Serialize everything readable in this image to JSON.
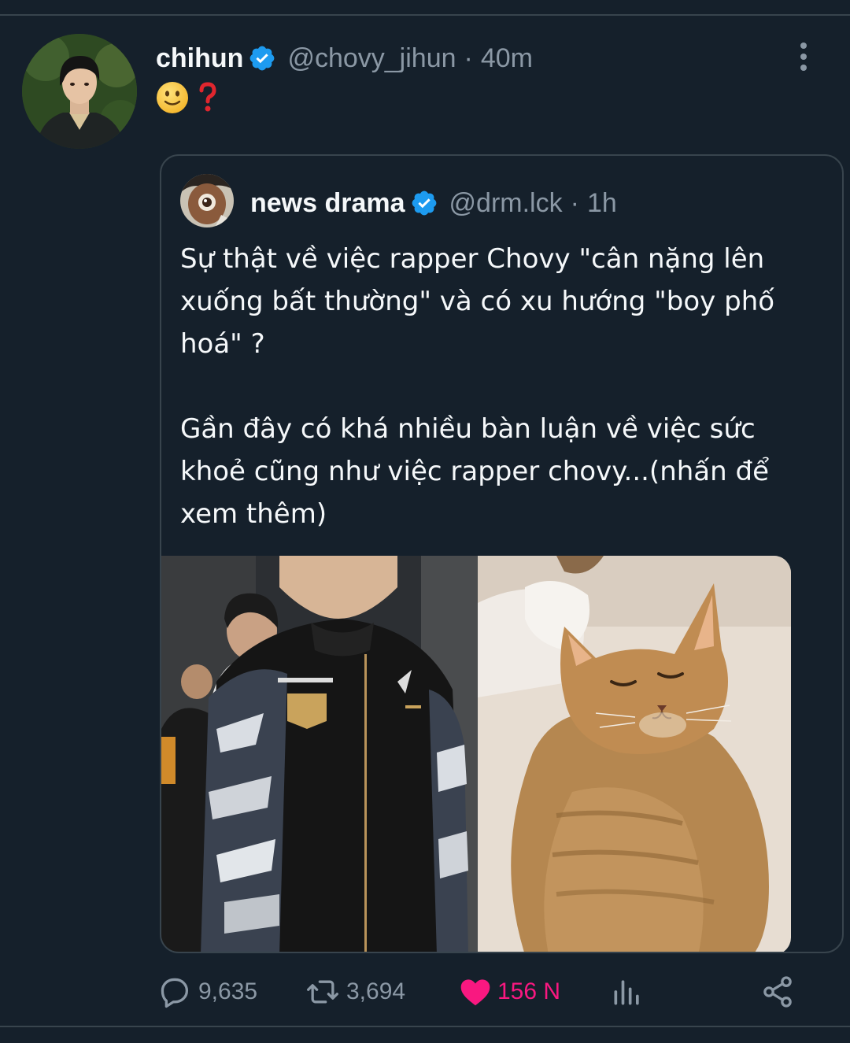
{
  "tweet": {
    "author": {
      "display_name": "chihun",
      "handle": "@chovy_jihun",
      "verified": true
    },
    "separator": "·",
    "time": "40m",
    "content_emoji": [
      "slightly-smiling-face",
      "red-question-mark"
    ],
    "quote": {
      "author": {
        "display_name": "news drama",
        "handle": "@drm.lck",
        "verified": true
      },
      "separator": "·",
      "time": "1h",
      "text_paragraph_1": "Sự thật về việc rapper Chovy \"cân nặng lên xuống bất thường\" và có xu hướng \"boy phố hoá\" ?",
      "text_paragraph_2": "Gần đây có khá nhiều bàn luận về việc sức khoẻ cũng như việc rapper chovy...(nhấn để xem thêm)",
      "media": [
        "photo-person-in-gen-g-jacket",
        "photo-chubby-orange-cat"
      ]
    },
    "actions": {
      "replies": "9,635",
      "retweets": "3,694",
      "likes": "156 N",
      "liked": true
    }
  },
  "colors": {
    "background": "#15202b",
    "text_primary": "#f5f8fa",
    "text_secondary": "#8b98a5",
    "verified_blue": "#1d9bf0",
    "like_pink": "#f91880",
    "border": "#38444d"
  }
}
